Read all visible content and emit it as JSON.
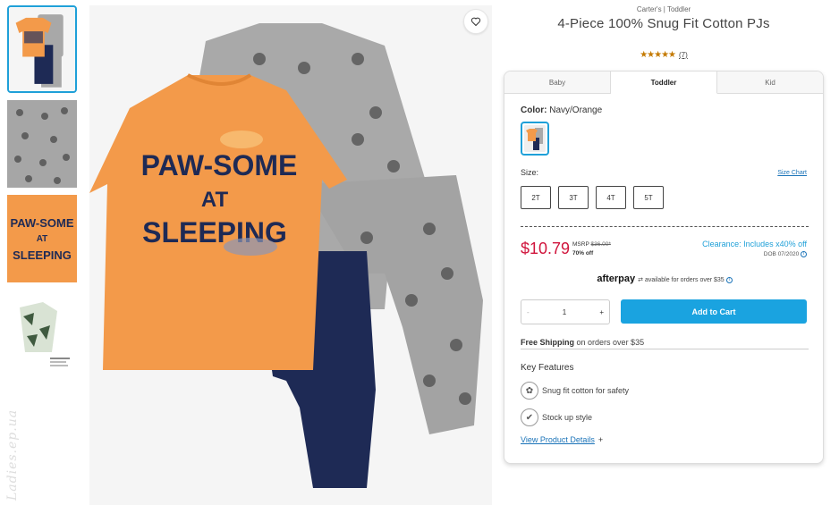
{
  "product": {
    "brand_line": "Carter's | Toddler",
    "title": "4-Piece 100% Snug Fit Cotton PJs",
    "stars": "★★★★★",
    "review_count": "(7)"
  },
  "tabs": [
    {
      "label": "Baby"
    },
    {
      "label": "Toddler"
    },
    {
      "label": "Kid"
    }
  ],
  "color": {
    "label": "Color:",
    "value": "Navy/Orange"
  },
  "size": {
    "label": "Size:",
    "chart_link": "Size Chart",
    "options": [
      "2T",
      "3T",
      "4T",
      "5T"
    ]
  },
  "pricing": {
    "price": "$10.79",
    "msrp_label": "MSRP",
    "msrp_value": "$36.00*",
    "discount": "70% off",
    "clearance": "Clearance: Includes x40% off",
    "dob": "DOB 07/2020"
  },
  "afterpay": {
    "logo": "afterpay",
    "text": "available for orders over $35"
  },
  "quantity": {
    "minus": "-",
    "value": "1",
    "plus": "+"
  },
  "cart": {
    "add_label": "Add to Cart"
  },
  "shipping": {
    "bold": "Free Shipping",
    "rest": "on orders over $35"
  },
  "features": {
    "title": "Key Features",
    "items": [
      {
        "label": "Snug fit cotton for safety",
        "icon": "cotton-icon"
      },
      {
        "label": "Stock up style",
        "icon": "checkmark-icon"
      }
    ],
    "details_link": "View Product Details",
    "details_plus": "+"
  },
  "image": {
    "shirt_text_line1": "PAW-SOME",
    "shirt_text_line2": "AT",
    "shirt_text_line3": "SLEEPING"
  },
  "watermark": "Ladies.ep.ua",
  "colors": {
    "accent": "#1aa3e0",
    "price": "#d0143c",
    "orange": "#f39a4a",
    "navy": "#1e2a55",
    "gray": "#9a9a9a"
  }
}
